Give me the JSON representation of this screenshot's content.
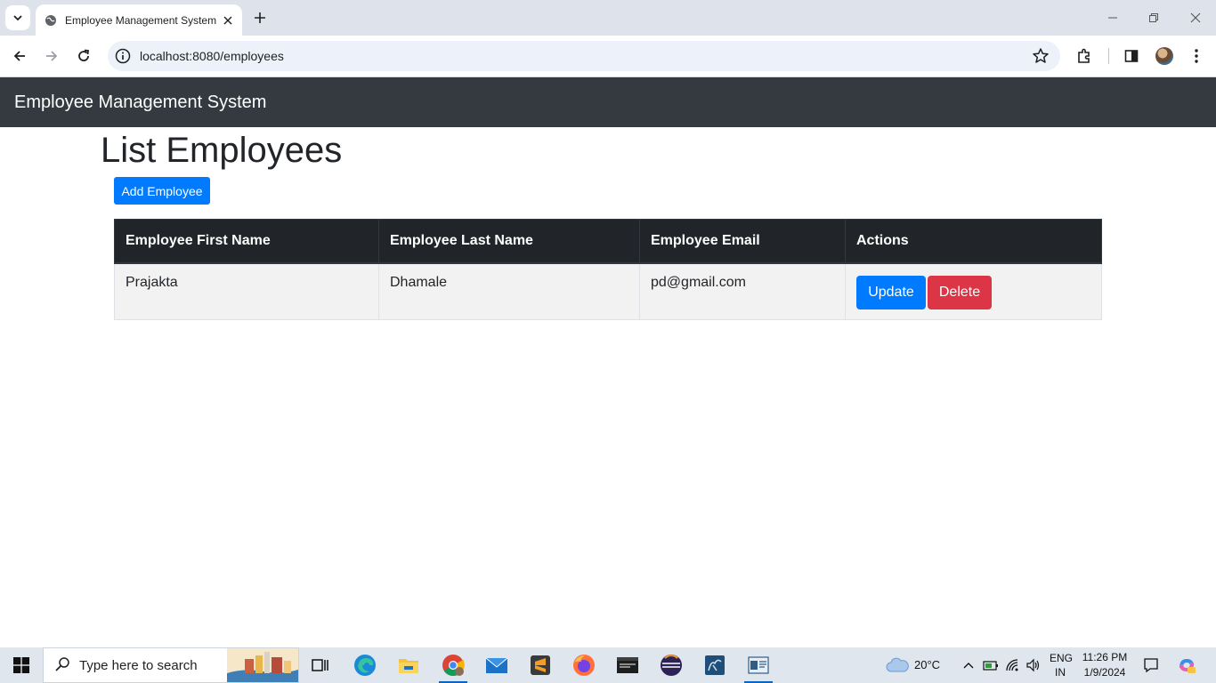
{
  "browser": {
    "tab_title": "Employee Management System",
    "url": "localhost:8080/employees"
  },
  "app": {
    "brand": "Employee Management System",
    "page_title": "List Employees",
    "add_button": "Add Employee",
    "table": {
      "headers": [
        "Employee First Name",
        "Employee Last Name",
        "Employee Email",
        "Actions"
      ],
      "rows": [
        {
          "first_name": "Prajakta",
          "last_name": "Dhamale",
          "email": "pd@gmail.com",
          "update_label": "Update",
          "delete_label": "Delete"
        }
      ]
    }
  },
  "taskbar": {
    "search_placeholder": "Type here to search",
    "weather": "20°C",
    "lang_top": "ENG",
    "lang_bottom": "IN",
    "time": "11:26 PM",
    "date": "1/9/2024"
  },
  "colors": {
    "navbar": "#343a40",
    "primary": "#007bff",
    "danger": "#dc3545",
    "table_header": "#212529"
  }
}
